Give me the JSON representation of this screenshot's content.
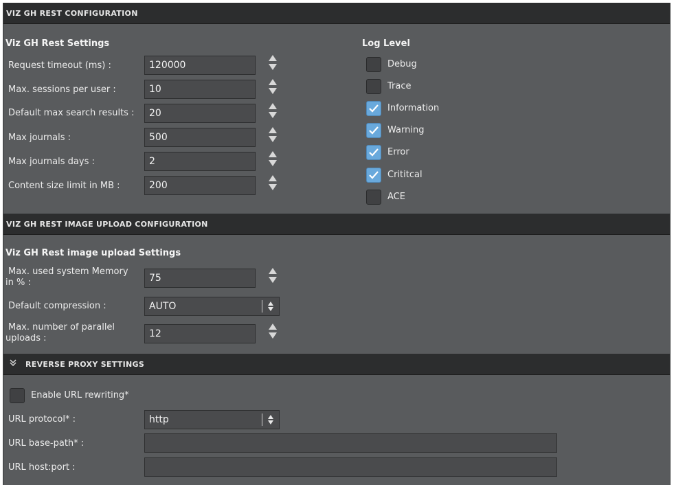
{
  "sections": {
    "rest_config": {
      "title": "VIZ GH REST CONFIGURATION"
    },
    "image_upload": {
      "title": "VIZ GH REST IMAGE UPLOAD CONFIGURATION"
    },
    "reverse_proxy": {
      "title": "REVERSE PROXY SETTINGS",
      "icon": "double-chevron-down-icon"
    }
  },
  "rest_settings": {
    "title": "Viz GH Rest Settings",
    "fields": [
      {
        "label": "Request timeout (ms) :",
        "value": "120000"
      },
      {
        "label": "Max. sessions per user :",
        "value": "10"
      },
      {
        "label": "Default max search results :",
        "value": "20"
      },
      {
        "label": "Max journals :",
        "value": "500"
      },
      {
        "label": "Max journals days :",
        "value": "2"
      },
      {
        "label": "Content size limit in MB :",
        "value": "200"
      }
    ]
  },
  "log_level": {
    "title": "Log Level",
    "options": [
      {
        "label": "Debug",
        "checked": false
      },
      {
        "label": "Trace",
        "checked": false
      },
      {
        "label": "Information",
        "checked": true
      },
      {
        "label": "Warning",
        "checked": true
      },
      {
        "label": "Error",
        "checked": true
      },
      {
        "label": "Crititcal",
        "checked": true
      },
      {
        "label": "ACE",
        "checked": false
      }
    ]
  },
  "image_upload_settings": {
    "title": "Viz GH Rest image upload Settings",
    "memory": {
      "label_line1": "Max. used system Memory",
      "label_line2": "in % :",
      "value": "75"
    },
    "compression": {
      "label": "Default compression :",
      "value": "AUTO"
    },
    "parallel": {
      "label_line1": "Max. number of parallel",
      "label_line2": "uploads :",
      "value": "12"
    }
  },
  "reverse_proxy": {
    "enable_rewriting": {
      "label": "Enable URL rewriting*",
      "checked": false
    },
    "protocol": {
      "label": "URL protocol* :",
      "value": "http"
    },
    "base_path": {
      "label": "URL base-path* :",
      "value": ""
    },
    "host_port": {
      "label": "URL host:port :",
      "value": ""
    }
  },
  "colors": {
    "panel": "#595b5d",
    "header": "#2c2d2e",
    "input": "#4a4b4d",
    "checkbox_on": "#69a9dc"
  }
}
